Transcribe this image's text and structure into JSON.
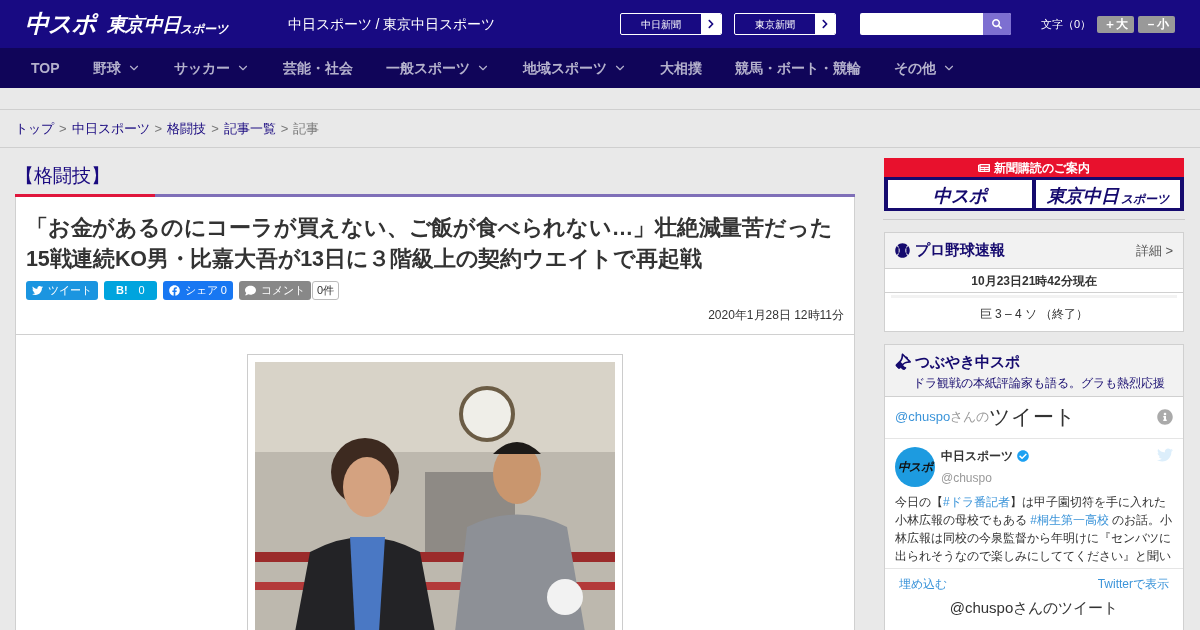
{
  "header": {
    "logo_main": "中スポ",
    "logo_sub": "東京中日",
    "logo_sub_small": "スポーツ",
    "site_title": "中日スポーツ / 東京中日スポーツ",
    "paper_links": [
      "中日新聞",
      "東京新聞"
    ],
    "font_size_label": "文字（0）",
    "font_buttons": [
      "＋大",
      "－小"
    ]
  },
  "nav": [
    {
      "label": "TOP",
      "has_menu": false
    },
    {
      "label": "野球",
      "has_menu": true
    },
    {
      "label": "サッカー",
      "has_menu": true
    },
    {
      "label": "芸能・社会",
      "has_menu": false
    },
    {
      "label": "一般スポーツ",
      "has_menu": true
    },
    {
      "label": "地域スポーツ",
      "has_menu": true
    },
    {
      "label": "大相撲",
      "has_menu": false
    },
    {
      "label": "競馬・ボート・競輪",
      "has_menu": false
    },
    {
      "label": "その他",
      "has_menu": true
    }
  ],
  "breadcrumb_separator": ">",
  "breadcrumb": [
    {
      "label": "トップ",
      "link": true
    },
    {
      "label": "中日スポーツ",
      "link": true
    },
    {
      "label": "格闘技",
      "link": true
    },
    {
      "label": "記事一覧",
      "link": true
    },
    {
      "label": "記事",
      "link": false
    }
  ],
  "category": "【格闘技】",
  "article": {
    "title": "「お金があるのにコーラが買えない、ご飯が食べられない…」壮絶減量苦だった15戦連続KO男・比嘉大吾が13日に３階級上の契約ウエイトで再起戦",
    "share_buttons": [
      {
        "kind": "twitter",
        "label": "ツイート",
        "color": "#1b95e0"
      },
      {
        "kind": "hatena",
        "label": "B!",
        "count": "0",
        "color": "#00a4de"
      },
      {
        "kind": "facebook",
        "label": "シェア 0",
        "color": "#1877f2"
      },
      {
        "kind": "comment",
        "label": "コメント",
        "color": "#888888"
      }
    ],
    "comment_count": "0件",
    "date": "2020年1月28日 12時11分"
  },
  "sidebar": {
    "subscription": {
      "title": "新聞購読のご案内",
      "logos": [
        {
          "kind": "main",
          "text": "中スポ"
        },
        {
          "kind": "sub",
          "text": "東京中日",
          "small": "スポーツ"
        }
      ]
    },
    "baseball": {
      "title": "プロ野球速報",
      "detail": "詳細 >",
      "updated": "10月23日21時42分現在",
      "games": [
        "巨 3 – 4 ソ （終了）"
      ]
    },
    "tweets": {
      "title": "つぶやき中スポ",
      "subtitle": "ドラ観戦の本紙評論家も語る。グラも熱烈応援",
      "timeline_handle": "@chuspo",
      "timeline_suffix": "さんの",
      "timeline_label": "ツイート",
      "tweet": {
        "name": "中日スポーツ",
        "verified": true,
        "handle": "@chuspo",
        "avatar_text": "中スポ",
        "segments": [
          {
            "kind": "plain",
            "text": "今日の【"
          },
          {
            "kind": "hashtag",
            "text": "#ドラ番記者"
          },
          {
            "kind": "plain",
            "text": "】は甲子園切符を手に入れた小林広報の母校でもある "
          },
          {
            "kind": "hashtag",
            "text": "#桐生第一高校"
          },
          {
            "kind": "plain",
            "text": " のお話。小林広報は同校の今泉監督から年明けに『センバツに出られそうなので楽しみにしててください』と聞い"
          }
        ]
      },
      "footer_links": [
        "埋め込む",
        "Twitterで表示"
      ],
      "next_header": "@chuspoさんのツイート"
    }
  }
}
